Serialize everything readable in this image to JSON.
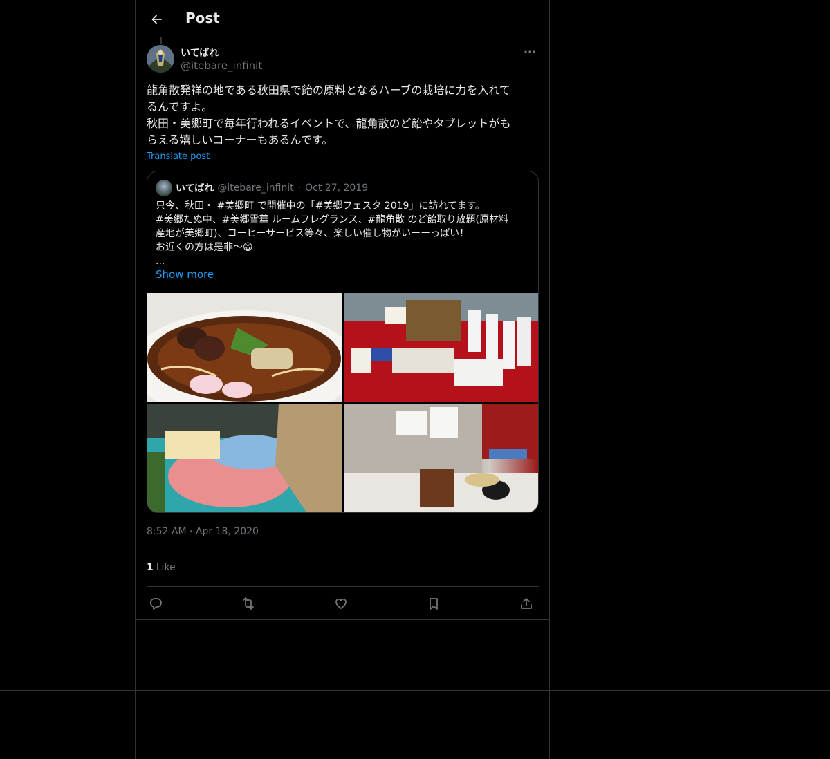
{
  "header": {
    "title": "Post",
    "back_icon": "arrow-left-icon"
  },
  "post": {
    "author_name": "いてばれ",
    "author_handle": "@itebare_infinit",
    "text": "龍角散発祥の地である秋田県で飴の原料となるハーブの栽培に力を入れて\nるんですよ。\n秋田・美郷町で毎年行われるイベントで、龍角散のど飴やタブレットがも\nらえる嬉しいコーナーもあるんです。",
    "translate_label": "Translate post",
    "timestamp": "8:52 AM · Apr 18, 2020",
    "likes_count": "1",
    "likes_label": "Like"
  },
  "quote": {
    "author_name": "いてばれ",
    "author_handle": "@itebare_infinit",
    "separator": "·",
    "date": "Oct 27, 2019",
    "text": "只今、秋田・ #美郷町 で開催中の「#美郷フェスタ 2019」に訪れてます。\n#美郷たぬ中、#美郷雪華 ルームフレグランス、#龍角散 のど飴取り放題(原材料\n産地が美郷町)、コーヒーサービス等々、楽しい催し物がいーーっぱい！\nお近くの方は是非〜😁\n...",
    "show_more": "Show more"
  },
  "actions": [
    "reply-icon",
    "repost-icon",
    "like-icon",
    "bookmark-icon",
    "share-icon"
  ],
  "colors": {
    "accent": "#1d9bf0",
    "background": "#000000",
    "muted": "#71767b",
    "border": "#2f3336"
  }
}
